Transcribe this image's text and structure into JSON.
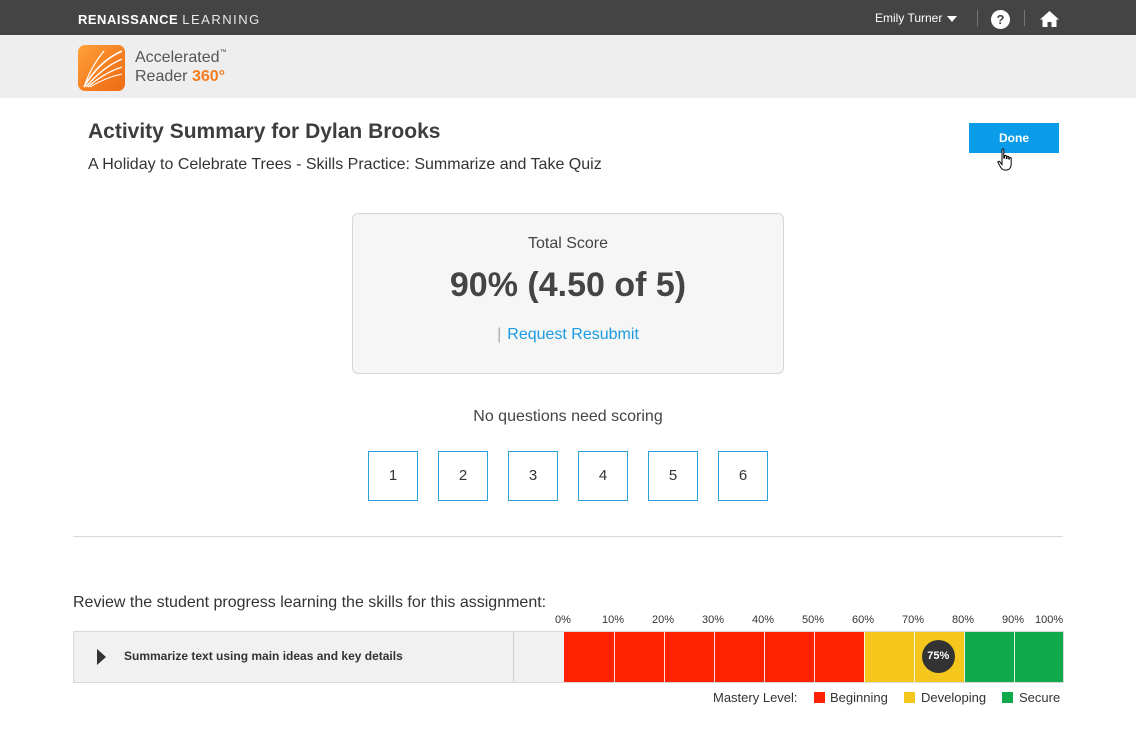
{
  "topbar": {
    "brand_bold": "RENAISSANCE",
    "brand_light": "LEARNING",
    "user_name": "Emily Turner",
    "help_glyph": "?"
  },
  "app": {
    "name_line1": "Accelerated",
    "tm": "™",
    "name_line2": "Reader",
    "name_num": "360°"
  },
  "page": {
    "title": "Activity Summary for Dylan Brooks",
    "subtitle": "A Holiday to Celebrate Trees - Skills Practice: Summarize and Take Quiz",
    "done_label": "Done"
  },
  "score": {
    "label": "Total Score",
    "value": "90% (4.50 of 5)",
    "pipe": "|",
    "resubmit_label": "Request Resubmit"
  },
  "no_questions": "No questions need scoring",
  "questions": [
    "1",
    "2",
    "3",
    "4",
    "5",
    "6"
  ],
  "review": {
    "text": "Review the student progress learning the skills for this assignment:",
    "skill": "Summarize text using main ideas and key details",
    "percent_labels": [
      "0%",
      "10%",
      "20%",
      "30%",
      "40%",
      "50%",
      "60%",
      "70%",
      "80%",
      "90%",
      "100%"
    ],
    "score_percent": 75,
    "score_label": "75%"
  },
  "legend": {
    "title": "Mastery Level:",
    "items": [
      {
        "label": "Beginning",
        "color": "#ff2200"
      },
      {
        "label": "Developing",
        "color": "#f5c71d"
      },
      {
        "label": "Secure",
        "color": "#10a94b"
      }
    ]
  },
  "colors": {
    "topbar": "#444444",
    "accent": "#0a9ce8",
    "brand_orange": "#f57c1f"
  }
}
